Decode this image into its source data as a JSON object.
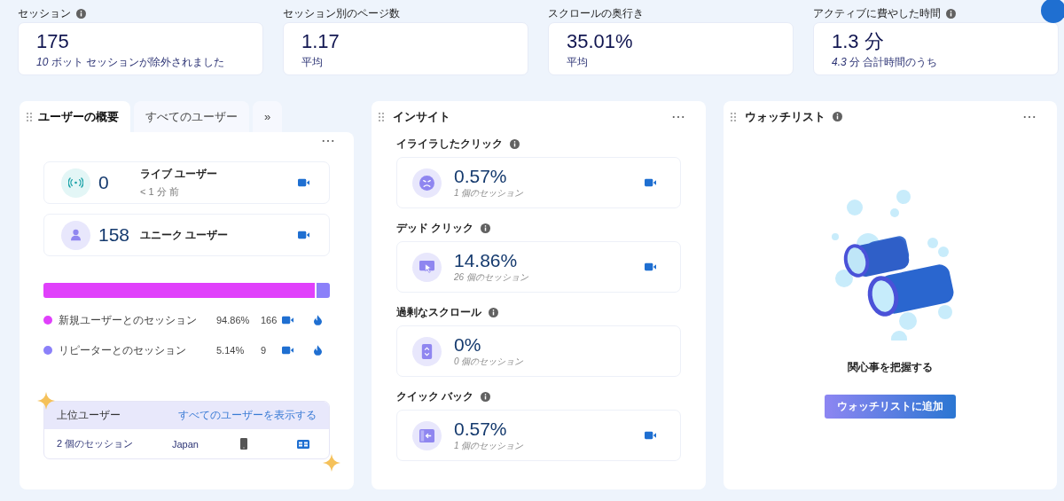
{
  "metrics": [
    {
      "label": "セッション",
      "info": true,
      "value": "175",
      "note": "*10* ボット セッションが除外されました"
    },
    {
      "label": "セッション別のページ数",
      "info": false,
      "value": "1.17",
      "note": "平均"
    },
    {
      "label": "スクロールの奥行き",
      "info": false,
      "value": "35.01%",
      "note": "平均"
    },
    {
      "label": "アクティブに費やした時間",
      "info": true,
      "value": "1.3 分",
      "note": "*4.3* 分 合計時間のうち"
    }
  ],
  "users_panel": {
    "tabs": [
      {
        "label": "ユーザーの概要",
        "selected": true
      },
      {
        "label": "すべてのユーザー",
        "selected": false
      },
      {
        "label": "»",
        "selected": false
      }
    ],
    "rows": [
      {
        "kind": "live",
        "count": "0",
        "label": "ライブ ユーザー",
        "sub": "< 1 分 前"
      },
      {
        "kind": "unique",
        "count": "158",
        "label": "ユニーク ユーザー"
      }
    ],
    "segments": [
      {
        "label": "新規ユーザーとのセッション",
        "percent": "94.86%",
        "count": "166",
        "level": 0.9486,
        "color": "#e040fb"
      },
      {
        "label": "リピーターとのセッション",
        "percent": "5.14%",
        "count": "9",
        "level": 0.0514,
        "color": "#8b80f9"
      }
    ],
    "top_users": {
      "title": "上位ユーザー",
      "link": "すべてのユーザーを表示する",
      "rows": [
        {
          "sessions": "2 個のセッション",
          "country": "Japan"
        }
      ]
    }
  },
  "insights": {
    "title": "インサイト",
    "items": [
      {
        "kind": "frustrated",
        "title": "イライラしたクリック",
        "value": "0.57%",
        "sessions": "1 個のセッション",
        "recording": true
      },
      {
        "kind": "dead",
        "title": "デッド クリック",
        "value": "14.86%",
        "sessions": "26 個のセッション",
        "recording": true
      },
      {
        "kind": "scroll",
        "title": "過剰なスクロール",
        "value": "0%",
        "sessions": "0 個のセッション",
        "recording": false
      },
      {
        "kind": "back",
        "title": "クイック バック",
        "value": "0.57%",
        "sessions": "1 個のセッション",
        "recording": true
      }
    ]
  },
  "watchlist": {
    "title": "ウォッチリスト",
    "caption": "関心事を把握する",
    "button": "ウォッチリストに追加"
  }
}
